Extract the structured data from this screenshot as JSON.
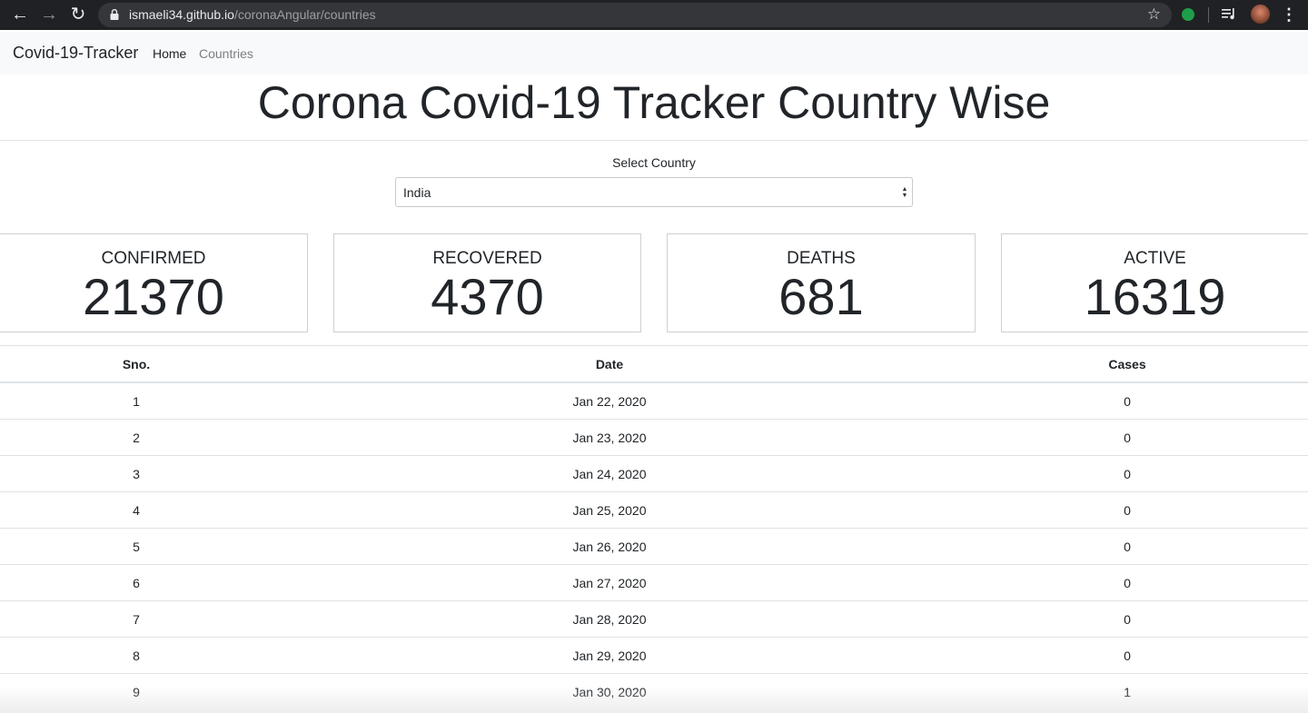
{
  "browser": {
    "url_host": "ismaeli34.github.io",
    "url_path": "/coronaAngular/countries",
    "back_icon": "arrow-left-icon",
    "forward_icon": "arrow-right-icon",
    "reload_icon": "reload-icon"
  },
  "navbar": {
    "brand": "Covid-19-Tracker",
    "links": [
      "Home",
      "Countries"
    ]
  },
  "page": {
    "title": "Corona Covid-19 Tracker Country Wise"
  },
  "country_select": {
    "label": "Select Country",
    "value": "India"
  },
  "stats": [
    {
      "label": "CONFIRMED",
      "value": "21370"
    },
    {
      "label": "RECOVERED",
      "value": "4370"
    },
    {
      "label": "DEATHS",
      "value": "681"
    },
    {
      "label": "ACTIVE",
      "value": "16319"
    }
  ],
  "table": {
    "headers": [
      "Sno.",
      "Date",
      "Cases"
    ],
    "rows": [
      [
        "1",
        "Jan 22, 2020",
        "0"
      ],
      [
        "2",
        "Jan 23, 2020",
        "0"
      ],
      [
        "3",
        "Jan 24, 2020",
        "0"
      ],
      [
        "4",
        "Jan 25, 2020",
        "0"
      ],
      [
        "5",
        "Jan 26, 2020",
        "0"
      ],
      [
        "6",
        "Jan 27, 2020",
        "0"
      ],
      [
        "7",
        "Jan 28, 2020",
        "0"
      ],
      [
        "8",
        "Jan 29, 2020",
        "0"
      ],
      [
        "9",
        "Jan 30, 2020",
        "1"
      ]
    ]
  }
}
